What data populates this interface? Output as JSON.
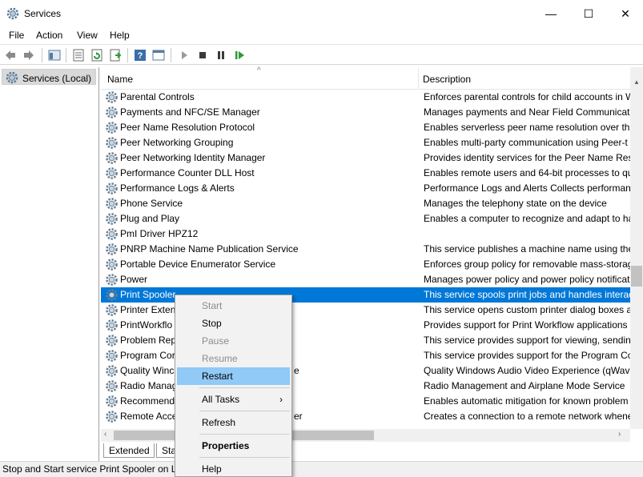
{
  "window": {
    "title": "Services",
    "min_glyph": "—",
    "max_glyph": "☐",
    "close_glyph": "✕"
  },
  "menu": [
    "File",
    "Action",
    "View",
    "Help"
  ],
  "tree": {
    "root_label": "Services (Local)"
  },
  "columns": {
    "name": "Name",
    "description": "Description"
  },
  "services": [
    {
      "name": "Parental Controls",
      "description": "Enforces parental controls for child accounts in W"
    },
    {
      "name": "Payments and NFC/SE Manager",
      "description": "Manages payments and Near Field Communicati"
    },
    {
      "name": "Peer Name Resolution Protocol",
      "description": "Enables serverless peer name resolution over the"
    },
    {
      "name": "Peer Networking Grouping",
      "description": "Enables multi-party communication using Peer-t"
    },
    {
      "name": "Peer Networking Identity Manager",
      "description": "Provides identity services for the Peer Name Reso"
    },
    {
      "name": "Performance Counter DLL Host",
      "description": "Enables remote users and 64-bit processes to qu"
    },
    {
      "name": "Performance Logs & Alerts",
      "description": "Performance Logs and Alerts Collects performan"
    },
    {
      "name": "Phone Service",
      "description": "Manages the telephony state on the device"
    },
    {
      "name": "Plug and Play",
      "description": "Enables a computer to recognize and adapt to ha"
    },
    {
      "name": "PmI Driver HPZ12",
      "description": ""
    },
    {
      "name": "PNRP Machine Name Publication Service",
      "description": "This service publishes a machine name using the"
    },
    {
      "name": "Portable Device Enumerator Service",
      "description": "Enforces group policy for removable mass-storag"
    },
    {
      "name": "Power",
      "description": "Manages power policy and power policy notificat"
    },
    {
      "name": "Print Spooler",
      "description": "This service spools print jobs and handles interac"
    },
    {
      "name": "Printer Exten",
      "description": "This service opens custom printer dialog boxes an"
    },
    {
      "name": "PrintWorkflo",
      "description": "Provides support for Print Workflow applications"
    },
    {
      "name": "Problem Rep",
      "description": "This service provides support for viewing, sendin"
    },
    {
      "name": "Program Cor",
      "description": "This service provides support for the Program Co"
    },
    {
      "name": "Quality Winc",
      "description": "Quality Windows Audio Video Experience (qWav"
    },
    {
      "name": "Radio Manag",
      "description": "Radio Management and Airplane Mode Service"
    },
    {
      "name": "Recommend",
      "description": "Enables automatic mitigation for known problem"
    },
    {
      "name": "Remote Acce",
      "description": "Creates a connection to a remote network whene"
    }
  ],
  "selected_index": 13,
  "name_fragments": [
    {
      "row": 18,
      "text": "e"
    },
    {
      "row": 21,
      "text": "er"
    }
  ],
  "context_menu": {
    "start": "Start",
    "stop": "Stop",
    "pause": "Pause",
    "resume": "Resume",
    "restart": "Restart",
    "all_tasks": "All Tasks",
    "all_tasks_arrow": "›",
    "refresh": "Refresh",
    "properties": "Properties",
    "help": "Help"
  },
  "tabs": {
    "extended": "Extended",
    "standard": "Sta"
  },
  "status_text": "Stop and Start service Print Spooler on Lo",
  "scroll": {
    "up": "▲",
    "left": "‹",
    "right": "›",
    "sort": "^"
  },
  "colors": {
    "selection": "#0078d7",
    "menu_highlight": "#91c9f7",
    "play_green": "#2e9a3a"
  }
}
